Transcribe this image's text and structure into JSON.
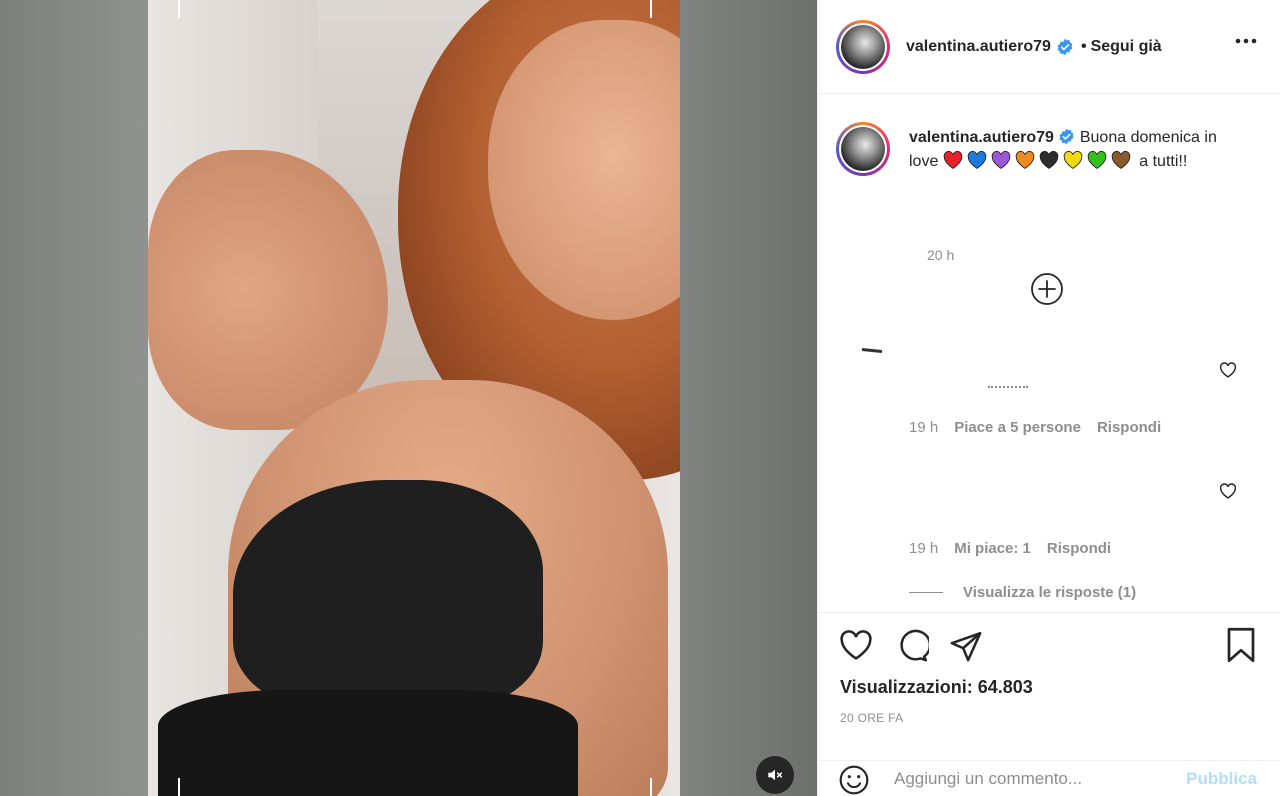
{
  "post": {
    "username": "valentina.autiero79",
    "dot": "•",
    "follow_label": "Segui già"
  },
  "caption": {
    "username": "valentina.autiero79",
    "text_before": "Buona domenica in love",
    "hearts": [
      {
        "name": "red-heart-icon",
        "color": "#e8202a"
      },
      {
        "name": "blue-heart-icon",
        "color": "#1d7be0"
      },
      {
        "name": "purple-heart-icon",
        "color": "#9b59d8"
      },
      {
        "name": "orange-heart-icon",
        "color": "#f28a1d"
      },
      {
        "name": "black-heart-icon",
        "color": "#2d2d2d"
      },
      {
        "name": "yellow-heart-icon",
        "color": "#f5d90a"
      },
      {
        "name": "green-heart-icon",
        "color": "#34c11c"
      },
      {
        "name": "brown-heart-icon",
        "color": "#8a5a2c"
      }
    ],
    "text_after": "a tutti!!",
    "time": "20 h"
  },
  "comments": [
    {
      "time": "19 h",
      "likes": "Piace a 5 persone",
      "reply": "Rispondi"
    },
    {
      "time": "19 h",
      "likes": "Mi piace: 1",
      "reply": "Rispondi"
    }
  ],
  "view_replies": "Visualizza le risposte (1)",
  "stats": {
    "views_label": "Visualizzazioni:",
    "views_value": "64.803",
    "time_ago": "20 ORE FA"
  },
  "composer": {
    "placeholder": "Aggiungi un commento...",
    "publish": "Pubblica"
  },
  "colors": {
    "accent": "#0095f6",
    "publish_disabled": "#b2dffc",
    "secondary_text": "#8e8e8e",
    "verified": "#3897f0"
  }
}
